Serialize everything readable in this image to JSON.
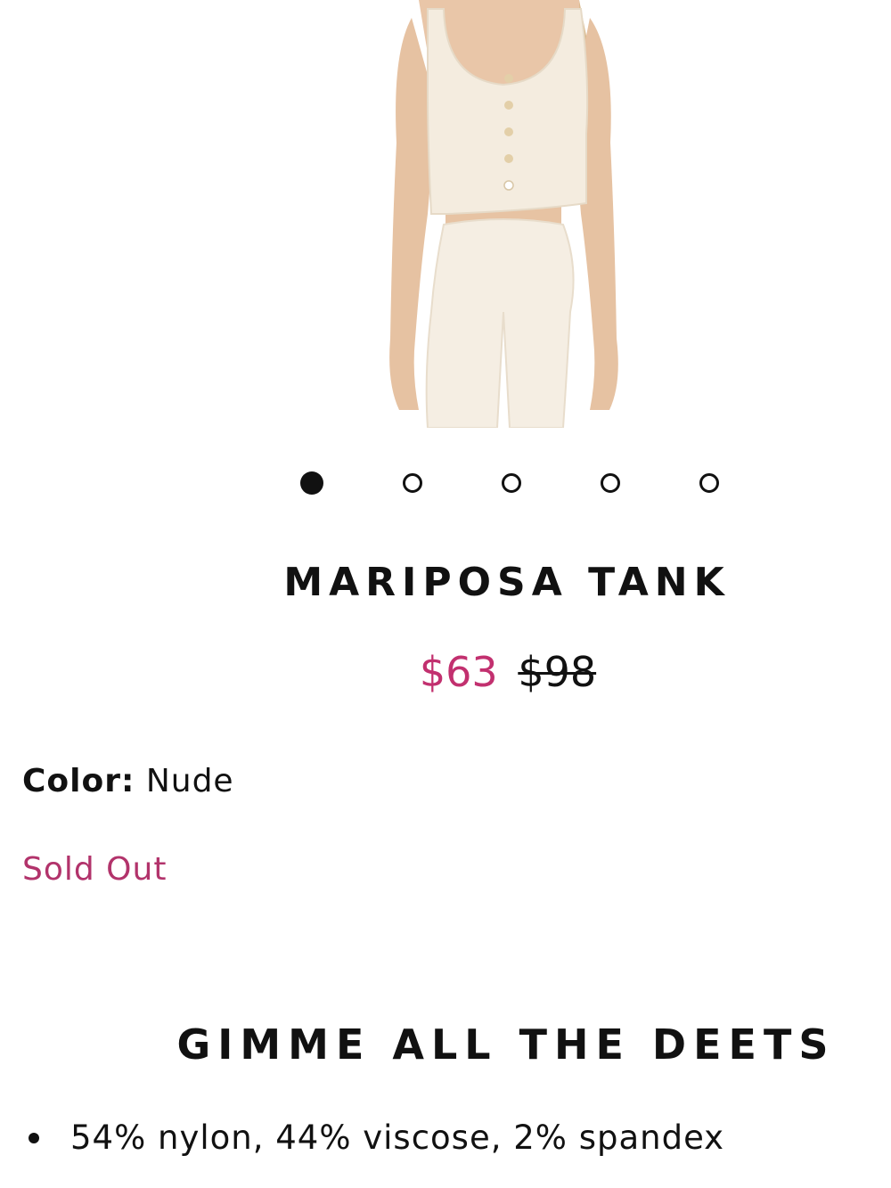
{
  "product": {
    "name": "MARIPOSA TANK",
    "sale_price": "$63",
    "original_price": "$98",
    "color_label": "Color:",
    "color_value": "Nude",
    "availability": "Sold Out"
  },
  "carousel": {
    "count": 5,
    "active_index": 0
  },
  "details": {
    "heading": "GIMME ALL THE DEETS",
    "items": [
      "54% nylon, 44% viscose, 2% spandex"
    ]
  },
  "colors": {
    "sale": "#c2306f",
    "sold_out": "#b2336b",
    "garment": "#f3eadb",
    "skin": "#e8c5a8"
  }
}
